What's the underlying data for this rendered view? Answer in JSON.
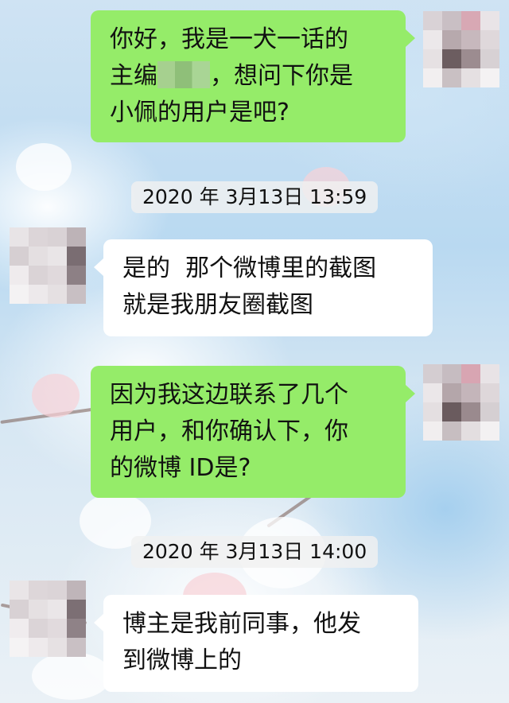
{
  "messages": [
    {
      "side": "right",
      "line1": "你好，我是一犬一话的",
      "line2_pre": "主编",
      "line2_post": "，想问下你是",
      "line3": "小佩的用户是吧?"
    },
    {
      "side": "left",
      "line1": "是的  那个微博里的截图",
      "line2": "就是我朋友圈截图"
    },
    {
      "side": "right",
      "line1": "因为我这边联系了几个",
      "line2": "用户，和你确认下，你",
      "line3": "的微博 ID是?"
    },
    {
      "side": "left",
      "line1": "博主是我前同事，他发",
      "line2": "到微博上的"
    }
  ],
  "timestamps": [
    "2020 年 3月13日 13:59",
    "2020 年 3月13日 14:00"
  ],
  "colors": {
    "outgoing_bubble": "#95ec69",
    "incoming_bubble": "#ffffff",
    "timestamp_bg": "#f0f0f0"
  }
}
